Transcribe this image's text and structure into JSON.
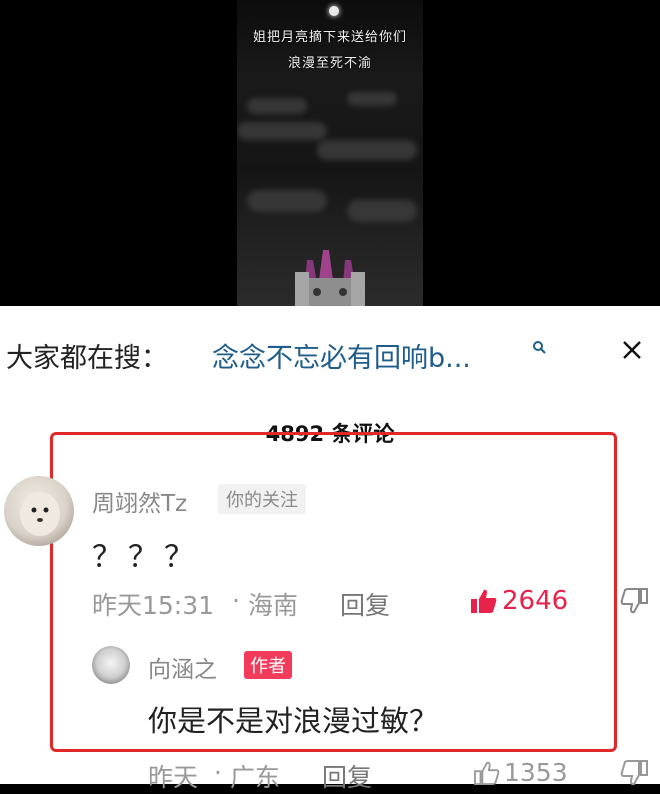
{
  "video": {
    "subtitle_line1": "姐把月亮摘下来送给你们",
    "subtitle_line2": "浪漫至死不渝"
  },
  "search_bar": {
    "prefix": "大家都在搜：",
    "query": "念念不忘必有回响b..."
  },
  "comments_header": {
    "count_text": "4892 条评论"
  },
  "comment": {
    "username": "周翊然Tz",
    "follow_tag": "你的关注",
    "text": "？？？",
    "time": "昨天15:31",
    "separator": "·",
    "location": "海南",
    "reply_label": "回复",
    "likes": "2646",
    "reply": {
      "username": "向涵之",
      "author_tag": "作者",
      "text": "你是不是对浪漫过敏？",
      "time": "昨天",
      "separator": "·",
      "location": "广东",
      "reply_label": "回复",
      "likes": "1353"
    }
  },
  "colors": {
    "highlight_border": "#e02a2a",
    "like_active": "#e8224a",
    "author_tag": "#f23b5a",
    "search_query": "#1f5d8a"
  }
}
